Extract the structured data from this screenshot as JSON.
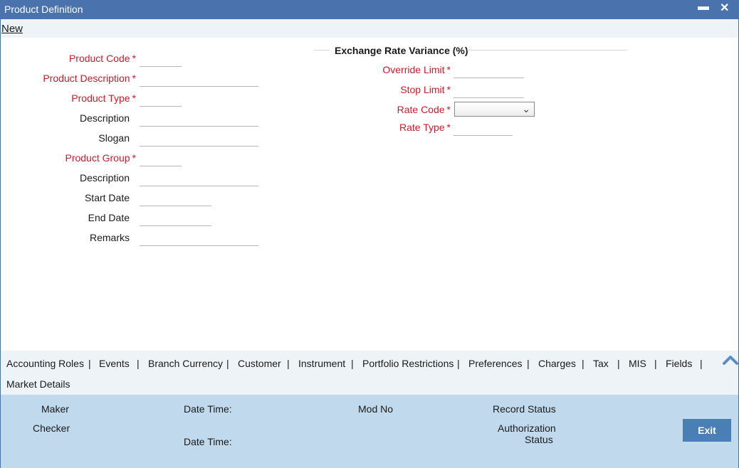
{
  "window": {
    "title": "Product Definition",
    "minimize_icon": "minimize-icon",
    "close_icon": "close-icon"
  },
  "menubar": {
    "new_label": "New"
  },
  "form": {
    "product_code": {
      "label": "Product Code",
      "value": ""
    },
    "product_description": {
      "label": "Product Description",
      "value": ""
    },
    "product_type": {
      "label": "Product Type",
      "value": ""
    },
    "description": {
      "label": "Description",
      "value": ""
    },
    "slogan": {
      "label": "Slogan",
      "value": ""
    },
    "product_group": {
      "label": "Product Group",
      "value": ""
    },
    "group_description": {
      "label": "Description",
      "value": ""
    },
    "start_date": {
      "label": "Start Date",
      "value": ""
    },
    "end_date": {
      "label": "End Date",
      "value": ""
    },
    "remarks": {
      "label": "Remarks",
      "value": ""
    },
    "required_marker": "*"
  },
  "exchange_rate": {
    "section_title": "Exchange Rate Variance (%)",
    "override_limit": {
      "label": "Override Limit",
      "value": ""
    },
    "stop_limit": {
      "label": "Stop Limit",
      "value": ""
    },
    "rate_code": {
      "label": "Rate Code",
      "selected": ""
    },
    "rate_type": {
      "label": "Rate Type",
      "value": ""
    }
  },
  "tabs": [
    {
      "label": "Accounting Roles"
    },
    {
      "label": "Events"
    },
    {
      "label": "Branch Currency"
    },
    {
      "label": "Customer"
    },
    {
      "label": "Instrument"
    },
    {
      "label": "Portfolio Restrictions"
    },
    {
      "label": "Preferences"
    },
    {
      "label": "Charges"
    },
    {
      "label": "Tax"
    },
    {
      "label": "MIS"
    },
    {
      "label": "Fields"
    },
    {
      "label": "Market Details"
    }
  ],
  "tab_separator": "|",
  "footer": {
    "maker": "Maker",
    "date_time_1": "Date Time:",
    "mod_no": "Mod No",
    "record_status": "Record Status",
    "checker": "Checker",
    "date_time_2": "Date Time:",
    "authorization_status_line1": "Authorization",
    "authorization_status_line2": "Status",
    "exit_label": "Exit"
  },
  "colors": {
    "title_bar": "#4a72ad",
    "required_label": "#cc1a2a",
    "footer_bg": "#c1d9ec",
    "tab_bar_bg": "#edf3f7",
    "exit_button": "#4a7fb5"
  }
}
